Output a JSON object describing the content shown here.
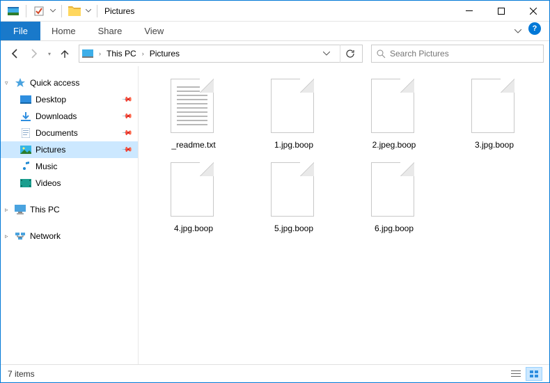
{
  "window": {
    "title": "Pictures"
  },
  "ribbon": {
    "file": "File",
    "tabs": [
      "Home",
      "Share",
      "View"
    ]
  },
  "breadcrumb": {
    "items": [
      "This PC",
      "Pictures"
    ]
  },
  "search": {
    "placeholder": "Search Pictures"
  },
  "sidebar": {
    "quick_access": {
      "label": "Quick access",
      "items": [
        {
          "label": "Desktop",
          "pinned": true,
          "icon": "desktop"
        },
        {
          "label": "Downloads",
          "pinned": true,
          "icon": "downloads"
        },
        {
          "label": "Documents",
          "pinned": true,
          "icon": "documents"
        },
        {
          "label": "Pictures",
          "pinned": true,
          "icon": "pictures",
          "selected": true
        },
        {
          "label": "Music",
          "pinned": false,
          "icon": "music"
        },
        {
          "label": "Videos",
          "pinned": false,
          "icon": "videos"
        }
      ]
    },
    "this_pc": {
      "label": "This PC"
    },
    "network": {
      "label": "Network"
    }
  },
  "files": [
    {
      "name": "_readme.txt",
      "type": "text"
    },
    {
      "name": "1.jpg.boop",
      "type": "blank"
    },
    {
      "name": "2.jpeg.boop",
      "type": "blank"
    },
    {
      "name": "3.jpg.boop",
      "type": "blank"
    },
    {
      "name": "4.jpg.boop",
      "type": "blank"
    },
    {
      "name": "5.jpg.boop",
      "type": "blank"
    },
    {
      "name": "6.jpg.boop",
      "type": "blank"
    }
  ],
  "status": {
    "count_label": "7 items"
  }
}
